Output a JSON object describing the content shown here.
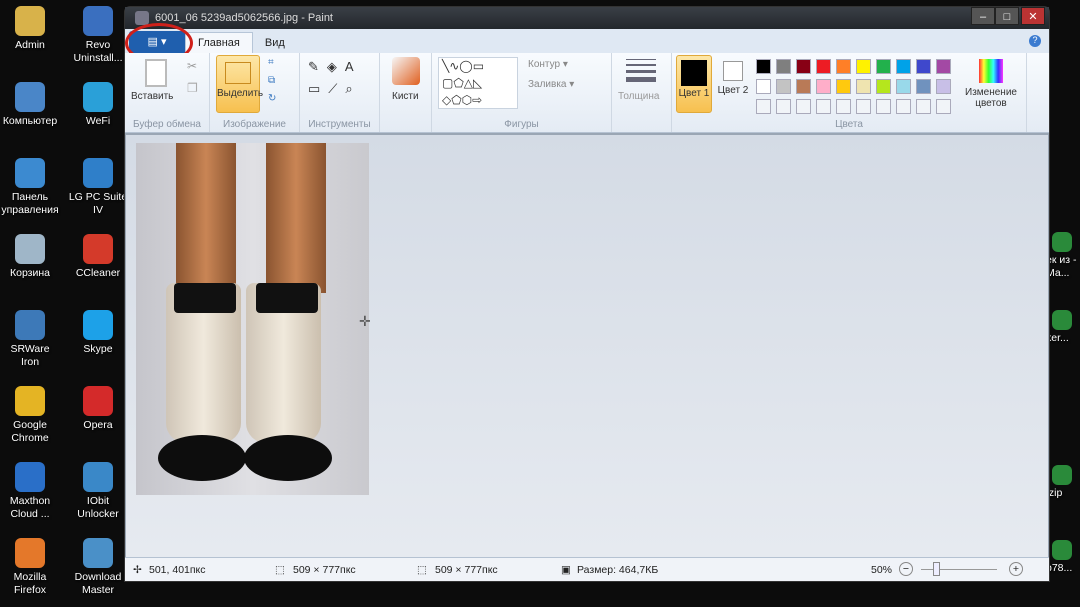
{
  "desktop_left": [
    {
      "label": "Admin",
      "color": "#d8b24a"
    },
    {
      "label": "Revo Uninstall...",
      "color": "#3a6fbf"
    },
    {
      "label": "Компьютер",
      "color": "#4a86c8"
    },
    {
      "label": "WeFi",
      "color": "#2aa0d8"
    },
    {
      "label": "Панель управления",
      "color": "#3c8ad0"
    },
    {
      "label": "LG PC Suite IV",
      "color": "#2f7fc9"
    },
    {
      "label": "Корзина",
      "color": "#9fb6c8"
    },
    {
      "label": "CCleaner",
      "color": "#d43a2a"
    },
    {
      "label": "SRWare Iron",
      "color": "#3d79b8"
    },
    {
      "label": "Skype",
      "color": "#1da1e8"
    },
    {
      "label": "Google Chrome",
      "color": "#e4b424"
    },
    {
      "label": "Opera",
      "color": "#d42a2a"
    },
    {
      "label": "Maxthon Cloud ...",
      "color": "#2a6fc8"
    },
    {
      "label": "IObit Unlocker",
      "color": "#3a88c8"
    },
    {
      "label": "Mozilla Firefox",
      "color": "#e4782a"
    },
    {
      "label": "Download Master",
      "color": "#4a90c8"
    }
  ],
  "desktop_right": [
    "ек из - Ма...",
    "ker...",
    ".zip",
    "b78..."
  ],
  "window": {
    "title": "6001_06          5239ad5062566.jpg - Paint"
  },
  "tabs": {
    "file": "▤ ▾",
    "home": "Главная",
    "view": "Вид"
  },
  "ribbon": {
    "clipboard": {
      "paste": "Вставить",
      "group": "Буфер обмена"
    },
    "image": {
      "select": "Выделить",
      "group": "Изображение"
    },
    "tools": {
      "group": "Инструменты"
    },
    "brushes": {
      "label": "Кисти"
    },
    "shapes": {
      "outline": "Контур ▾",
      "fill": "Заливка ▾",
      "group": "Фигуры"
    },
    "size": {
      "label": "Толщина"
    },
    "colors": {
      "color1": "Цвет 1",
      "color2": "Цвет 2",
      "edit": "Изменение цветов",
      "group": "Цвета",
      "palette_row1": [
        "#000000",
        "#7f7f7f",
        "#880015",
        "#ed1c24",
        "#ff7f27",
        "#fff200",
        "#22b14c",
        "#00a2e8",
        "#3f48cc",
        "#a349a4"
      ],
      "palette_row2": [
        "#ffffff",
        "#c3c3c3",
        "#b97a57",
        "#ffaec9",
        "#ffc90e",
        "#efe4b0",
        "#b5e61d",
        "#99d9ea",
        "#7092be",
        "#c8bfe7"
      ]
    }
  },
  "status": {
    "cursor": "501, 401пкс",
    "selection": "509 × 777пкс",
    "image_size": "509 × 777пкс",
    "file_size": "Размер: 464,7КБ",
    "zoom": "50%",
    "zoom_level_percent": 50
  }
}
